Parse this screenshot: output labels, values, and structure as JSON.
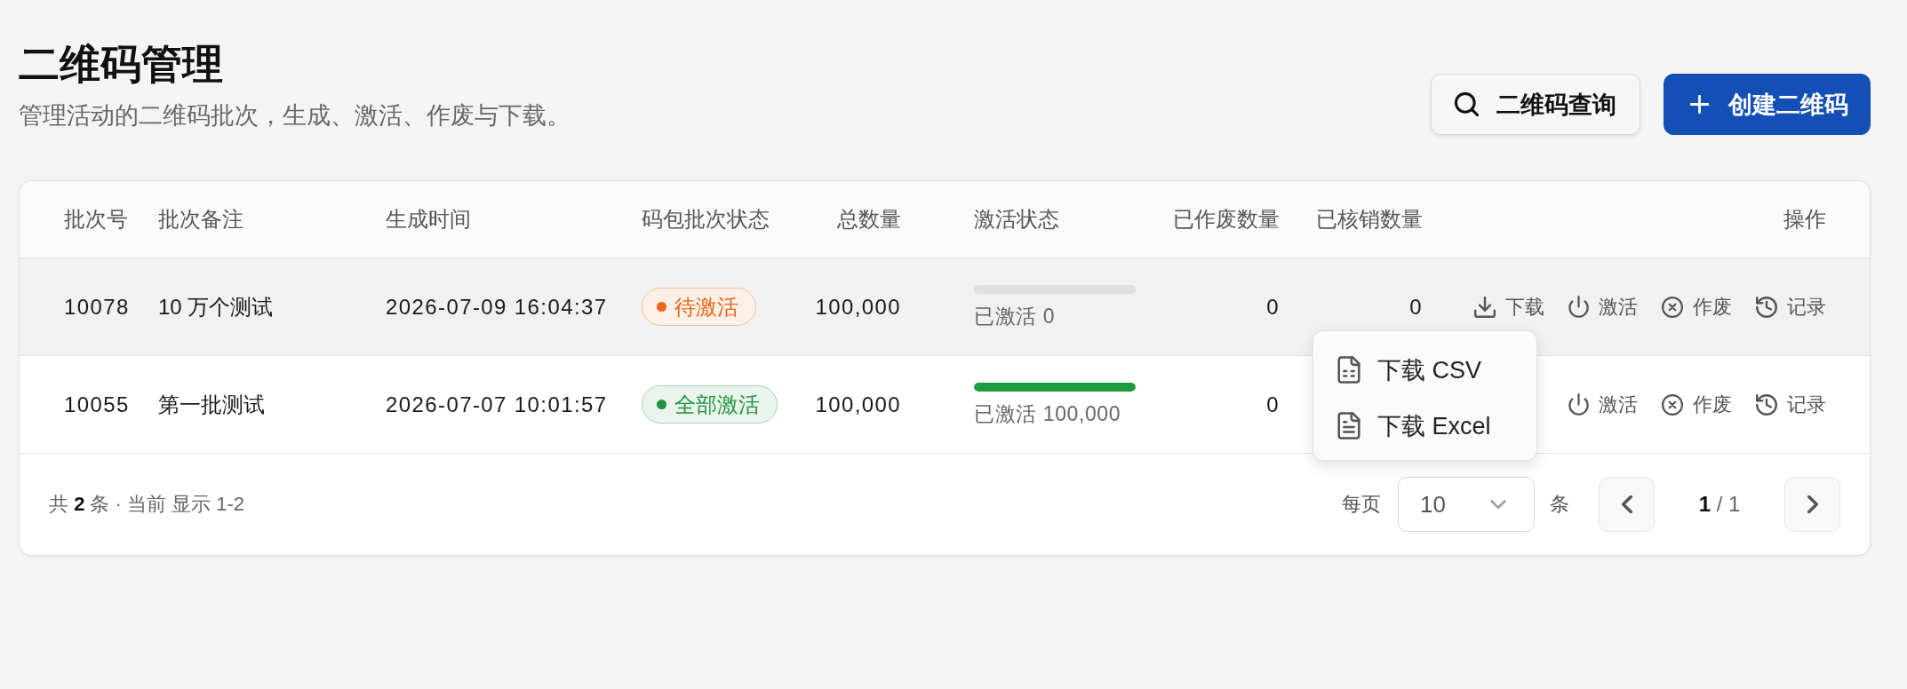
{
  "page": {
    "title": "二维码管理",
    "subtitle": "管理活动的二维码批次，生成、激活、作废与下载。"
  },
  "toolbar": {
    "buttons": [
      {
        "kind": "secondary",
        "label": "二维码查询"
      },
      {
        "kind": "primary",
        "label": "创建二维码"
      }
    ]
  },
  "table": {
    "columns": [
      "批次号",
      "批次备注",
      "生成时间",
      "码包批次状态",
      "总数量",
      "激活状态",
      "已作废数量",
      "已核销数量",
      "操作"
    ],
    "rows": [
      {
        "hovered": true,
        "batch_no": "10078",
        "note": "10 万个测试",
        "created_at": "2026-07-09 16:04:37",
        "status": {
          "label": "待激活",
          "color": "#ee6416"
        },
        "total": "100,000",
        "activation": {
          "level": 0,
          "reading": "已激活 0"
        },
        "voided": "0",
        "redeemed": "0",
        "actions": [
          {
            "kind": "download",
            "label": "下载"
          },
          {
            "kind": "activate",
            "label": "激活"
          },
          {
            "kind": "void",
            "label": "作废"
          },
          {
            "kind": "history",
            "label": "记录"
          }
        ]
      },
      {
        "hovered": false,
        "batch_no": "10055",
        "note": "第一批测试",
        "created_at": "2026-07-07 10:01:57",
        "status": {
          "label": "全部激活",
          "color": "#22923f"
        },
        "total": "100,000",
        "activation": {
          "level": 1,
          "reading": "已激活 100,000"
        },
        "voided": "0",
        "actions": [
          {
            "kind": "activate",
            "label": "激活"
          },
          {
            "kind": "void",
            "label": "作废"
          },
          {
            "kind": "history",
            "label": "记录"
          }
        ]
      }
    ],
    "download_menu": {
      "items": [
        {
          "kind": "csv",
          "label": "下载 CSV"
        },
        {
          "kind": "excel",
          "label": "下载 Excel"
        }
      ]
    }
  },
  "footer": {
    "summary": "共 **2** 条 · 当前 显示 1-2",
    "page_size": {
      "label": "每页",
      "value": "10",
      "unit": "条"
    },
    "page_indicator": "**1** / 1"
  }
}
